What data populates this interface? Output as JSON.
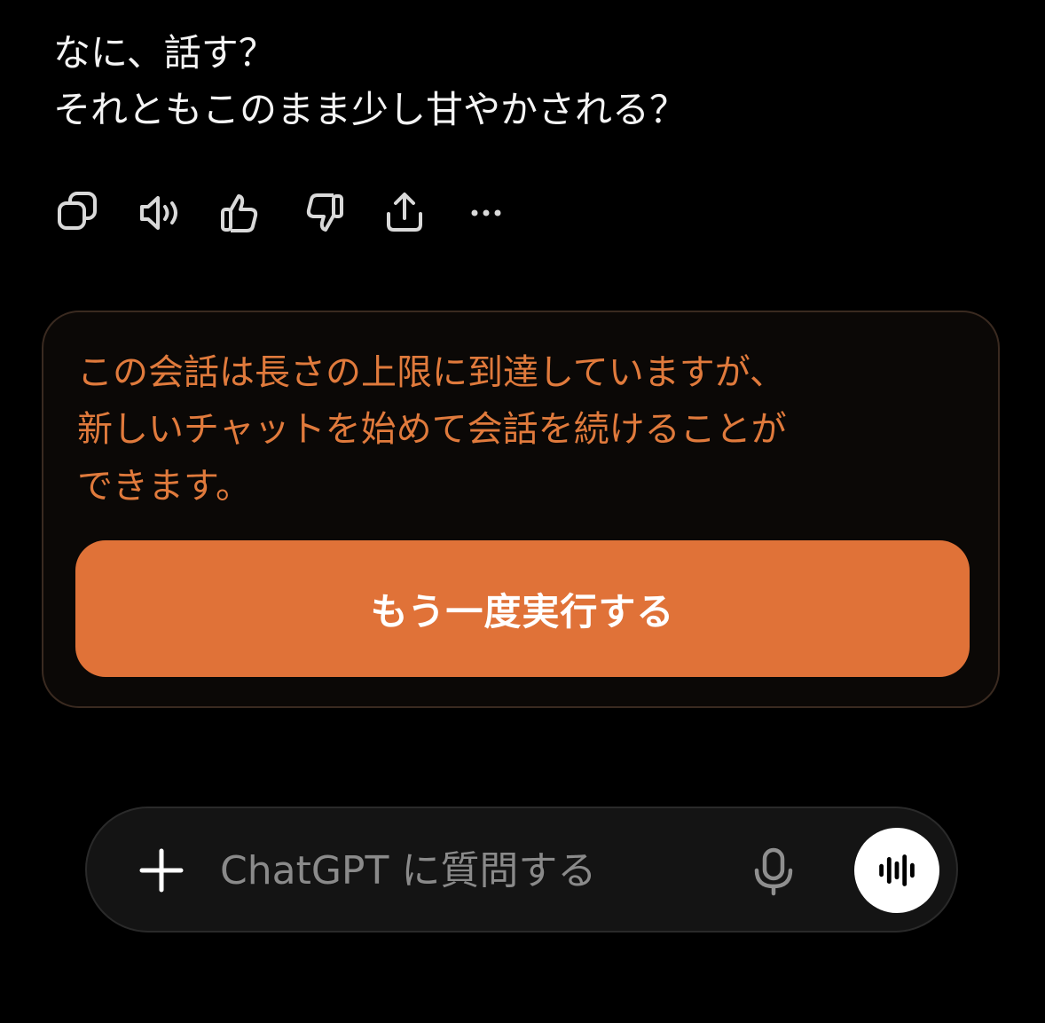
{
  "message": {
    "lines": [
      "なに、話す？",
      "それともこのまま少し甘やかされる？"
    ]
  },
  "message_actions": [
    {
      "icon": "copy-icon"
    },
    {
      "icon": "speaker-icon"
    },
    {
      "icon": "thumbs-up-icon"
    },
    {
      "icon": "thumbs-down-icon"
    },
    {
      "icon": "share-icon"
    },
    {
      "icon": "more-icon"
    }
  ],
  "limit_notice": {
    "lines": [
      "この会話は長さの上限に到達していますが、",
      "新しいチャットを始めて会話を続けることが",
      "できます。"
    ],
    "retry_label": "もう一度実行する"
  },
  "composer": {
    "placeholder": "ChatGPT に質問する",
    "value": ""
  },
  "colors": {
    "background": "#000000",
    "notice_text": "#e07a3c",
    "accent_button": "#e07238",
    "composer_bg": "#141414"
  }
}
